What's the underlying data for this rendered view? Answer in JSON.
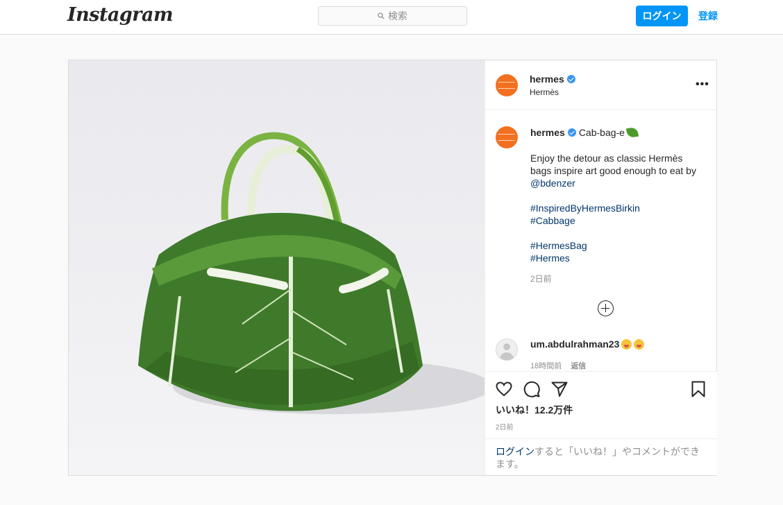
{
  "nav": {
    "logo": "Instagram",
    "search_placeholder": "検索",
    "login_label": "ログイン",
    "signup_label": "登録"
  },
  "post": {
    "author": {
      "username": "hermes",
      "display_name": "Hermès",
      "verified": true
    },
    "caption": {
      "username": "hermes",
      "title": "Cab-bag-e",
      "title_emoji": "leafy-green",
      "lines": [
        {
          "text": "Enjoy the detour as classic Hermès",
          "link": false
        },
        {
          "text": "bags inspire art good enough to eat by",
          "link": false
        },
        {
          "text": "@bdenzer",
          "link": true
        },
        {
          "text": "",
          "link": false
        },
        {
          "text": "#InspiredByHermesBirkin",
          "link": true
        },
        {
          "text": "#Cabbage",
          "link": true
        },
        {
          "text": "",
          "link": false
        },
        {
          "text": "#HermesBag",
          "link": true
        },
        {
          "text": "#Hermes",
          "link": true
        }
      ],
      "time": "2日前"
    },
    "comment": {
      "username": "um.abdulrahman23",
      "emojis": [
        "zany-face",
        "zany-face"
      ],
      "time": "18時間前",
      "reply_label": "返信"
    },
    "likes": "いいね！12.2万件",
    "time": "2日前",
    "login_prompt": {
      "link": "ログイン",
      "rest": "すると「いいね！」やコメントができます。"
    }
  },
  "colors": {
    "accent": "#0095f6",
    "brand_orange": "#f37021",
    "link": "#00376b",
    "muted": "#8e8e8e"
  }
}
